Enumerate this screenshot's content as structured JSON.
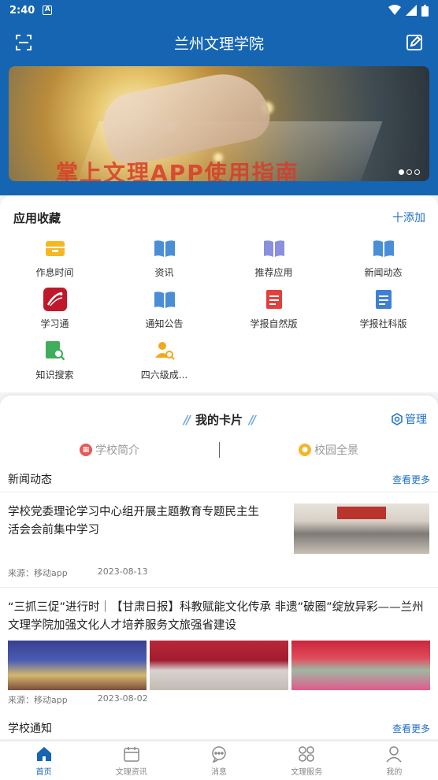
{
  "status": {
    "time": "2:40",
    "notif": "A"
  },
  "header": {
    "title": "兰州文理学院"
  },
  "banner": {
    "caption": "掌上文理APP使用指南"
  },
  "apps": {
    "title": "应用收藏",
    "add_label": "十添加",
    "items": [
      {
        "label": "作息时间",
        "icon": "inbox-tray-icon",
        "color": "#f5b823"
      },
      {
        "label": "资讯",
        "icon": "open-book-icon",
        "color": "#4a8ed8"
      },
      {
        "label": "推荐应用",
        "icon": "open-book-icon",
        "color": "#8a8fe0"
      },
      {
        "label": "新闻动态",
        "icon": "open-book-icon",
        "color": "#4a8ed8"
      },
      {
        "label": "学习通",
        "icon": "xuexitong-logo-icon",
        "color": "#c0182b"
      },
      {
        "label": "通知公告",
        "icon": "open-book-icon",
        "color": "#4a8ed8"
      },
      {
        "label": "学报自然版",
        "icon": "document-icon",
        "color": "#e0413f"
      },
      {
        "label": "学报社科版",
        "icon": "document-icon",
        "color": "#3f7fd4"
      },
      {
        "label": "知识搜索",
        "icon": "book-search-icon",
        "color": "#3fae5a"
      },
      {
        "label": "四六级成...",
        "icon": "user-search-icon",
        "color": "#f2a81c"
      }
    ]
  },
  "cards": {
    "title": "我的卡片",
    "manage_label": "管理",
    "tabs": {
      "left": "学校简介",
      "right": "校园全景"
    }
  },
  "news": {
    "section_title": "新闻动态",
    "more": "查看更多",
    "items": [
      {
        "title": "学校党委理论学习中心组开展主题教育专题民主生活会会前集中学习",
        "source": "来源：移动app",
        "date": "2023-08-13"
      },
      {
        "title": "“三抓三促”进行时｜【甘肃日报】科教赋能文化传承 非遗”破圈”绽放异彩——兰州文理学院加强文化人才培养服务文旅强省建设",
        "source": "来源：移动app",
        "date": "2023-08-02"
      }
    ]
  },
  "notices": {
    "section_title": "学校通知",
    "more": "查看更多"
  },
  "tabbar": {
    "items": [
      {
        "label": "首页",
        "icon": "home-icon"
      },
      {
        "label": "文理资讯",
        "icon": "calendar-icon"
      },
      {
        "label": "消息",
        "icon": "chat-bubble-icon"
      },
      {
        "label": "文理服务",
        "icon": "grid-icon"
      },
      {
        "label": "我的",
        "icon": "user-icon"
      }
    ]
  }
}
